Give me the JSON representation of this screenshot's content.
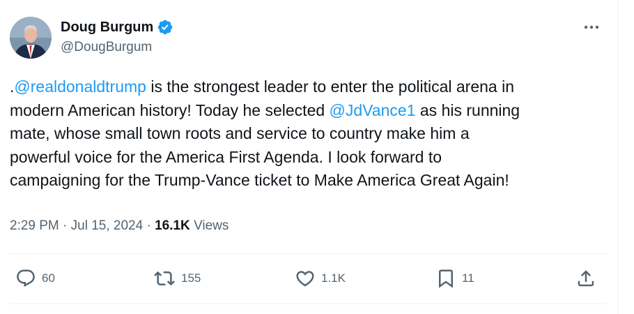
{
  "author": {
    "display_name": "Doug Burgum",
    "handle": "@DougBurgum",
    "verified": true
  },
  "tweet": {
    "lines": [
      [
        {
          "t": "."
        },
        {
          "t": "@realdonaldtrump",
          "mention": true
        },
        {
          "t": " is the strongest leader to enter the political arena in"
        }
      ],
      [
        {
          "t": "modern American history! Today he selected "
        },
        {
          "t": "@JdVance1",
          "mention": true
        },
        {
          "t": " as his running"
        }
      ],
      [
        {
          "t": "mate, whose small town roots and service to country make him a"
        }
      ],
      [
        {
          "t": "powerful voice for the America First Agenda. I look forward to"
        }
      ],
      [
        {
          "t": "campaigning for the Trump-Vance ticket to Make America Great Again!"
        }
      ]
    ],
    "time": "2:29 PM",
    "date": "Jul 15, 2024",
    "views_count": "16.1K",
    "views_label": "Views",
    "separator": "·"
  },
  "actions": {
    "replies": "60",
    "retweets": "155",
    "likes": "1.1K",
    "bookmarks": "11"
  },
  "colors": {
    "accent": "#1d9bf0",
    "text": "#0f1419",
    "muted": "#536471",
    "divider": "#eff3f4"
  }
}
